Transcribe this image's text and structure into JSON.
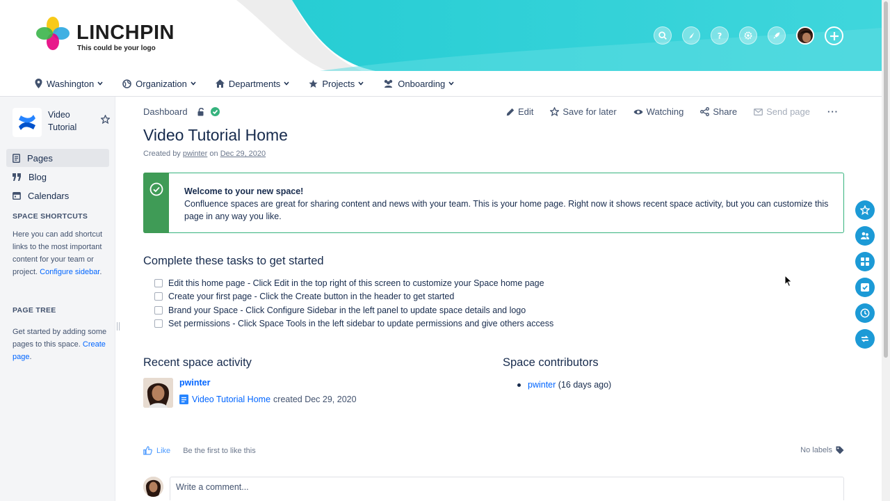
{
  "brand": {
    "name": "LINCHPIN",
    "tagline": "This could be your logo",
    "colors": {
      "teal": "#2ccfd6",
      "link": "#0065ff",
      "success": "#3f9b56",
      "float_btn": "#1c9ad6"
    }
  },
  "header_icons": [
    "search-icon",
    "compass-icon",
    "help-icon",
    "gear-icon",
    "rocket-icon",
    "avatar",
    "plus-icon"
  ],
  "nav": [
    {
      "label": "Washington",
      "icon": "location-pin-icon"
    },
    {
      "label": "Organization",
      "icon": "globe-icon"
    },
    {
      "label": "Departments",
      "icon": "home-icon"
    },
    {
      "label": "Projects",
      "icon": "star-icon"
    },
    {
      "label": "Onboarding",
      "icon": "people-icon"
    }
  ],
  "sidebar": {
    "space_name": "Video Tutorial",
    "items": [
      {
        "label": "Pages",
        "icon": "pages-icon",
        "active": true
      },
      {
        "label": "Blog",
        "icon": "quote-icon"
      },
      {
        "label": "Calendars",
        "icon": "calendar-icon"
      }
    ],
    "shortcuts_heading": "SPACE SHORTCUTS",
    "shortcuts_text": "Here you can add shortcut links to the most important content for your team or project.",
    "shortcuts_link": "Configure sidebar",
    "tree_heading": "PAGE TREE",
    "tree_text": "Get started by adding some pages to this space.",
    "tree_link": "Create page"
  },
  "page": {
    "breadcrumb": "Dashboard",
    "actions": {
      "edit": "Edit",
      "save_for_later": "Save for later",
      "watching": "Watching",
      "share": "Share",
      "send_page": "Send page",
      "more": "···"
    },
    "title": "Video Tutorial Home",
    "byline_prefix": "Created by",
    "author": "pwinter",
    "byline_on": "on",
    "created_date": "Dec 29, 2020",
    "panel": {
      "title": "Welcome to your new space!",
      "body": "Confluence spaces are great for sharing content and news with your team. This is your home page. Right now it shows recent space activity, but you can customize this page in any way you like."
    },
    "tasks_heading": "Complete these tasks to get started",
    "tasks": [
      "Edit this home page - Click Edit in the top right of this screen to customize your Space home page",
      "Create your first page - Click the Create button in the header to get started",
      "Brand your Space - Click Configure Sidebar in the left panel to update space details and logo",
      "Set permissions - Click Space Tools in the left sidebar to update permissions and give others access"
    ],
    "recent_heading": "Recent space activity",
    "activity": {
      "user": "pwinter",
      "page_link": "Video Tutorial Home",
      "text": "created Dec 29, 2020"
    },
    "contributors_heading": "Space contributors",
    "contributor": {
      "name": "pwinter",
      "when": "(16 days ago)"
    },
    "like_label": "Like",
    "like_text": "Be the first to like this",
    "labels_text": "No labels",
    "comment_placeholder": "Write a comment..."
  },
  "float_buttons": [
    "star-icon",
    "people-icon",
    "grid-icon",
    "checkbox-icon",
    "clock-icon",
    "transfer-icon"
  ]
}
